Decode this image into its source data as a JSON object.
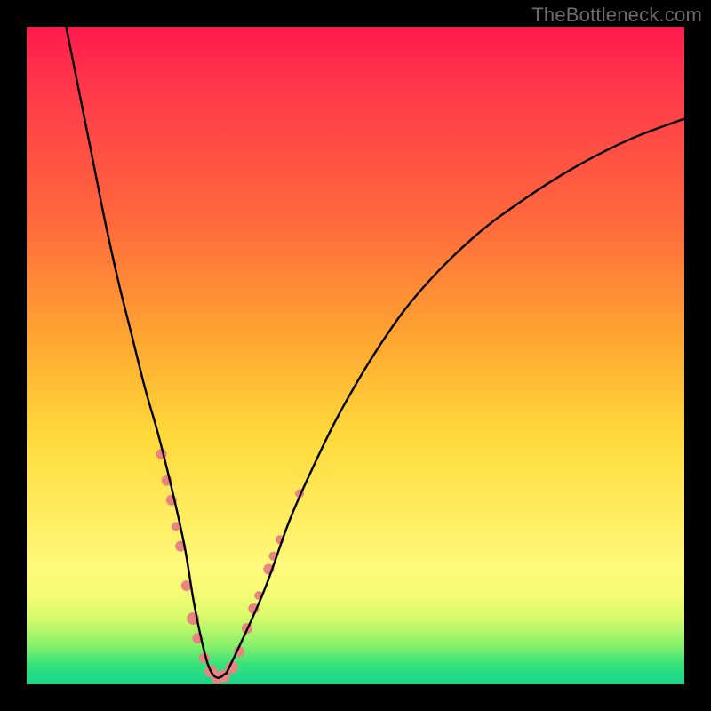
{
  "watermark": "TheBottleneck.com",
  "chart_data": {
    "type": "line",
    "title": "",
    "xlabel": "",
    "ylabel": "",
    "xlim": [
      0,
      100
    ],
    "ylim": [
      0,
      100
    ],
    "series": [
      {
        "name": "curve",
        "color": "#000000",
        "x": [
          6,
          8,
          10,
          12,
          14,
          16,
          18,
          20,
          22,
          24,
          25.5,
          27,
          28,
          29,
          30,
          31,
          36,
          40,
          44,
          48,
          54,
          60,
          68,
          76,
          84,
          92,
          100
        ],
        "y": [
          100,
          90,
          80,
          70,
          61,
          53,
          45,
          38,
          30,
          21,
          12,
          5,
          2,
          1,
          1.5,
          3,
          14,
          25,
          34,
          42,
          52,
          60,
          68,
          74,
          79,
          83,
          86
        ]
      }
    ],
    "markers": [
      {
        "name": "cluster-left",
        "color": "#e98481",
        "points": [
          {
            "x": 20.5,
            "y": 35,
            "r": 6
          },
          {
            "x": 21.3,
            "y": 31,
            "r": 6
          },
          {
            "x": 22.0,
            "y": 28,
            "r": 6
          },
          {
            "x": 22.7,
            "y": 24,
            "r": 5
          },
          {
            "x": 23.4,
            "y": 21,
            "r": 6
          },
          {
            "x": 24.3,
            "y": 15,
            "r": 6
          },
          {
            "x": 25.3,
            "y": 10,
            "r": 7
          },
          {
            "x": 26.0,
            "y": 7,
            "r": 6
          },
          {
            "x": 27.0,
            "y": 4,
            "r": 6
          },
          {
            "x": 28.0,
            "y": 2,
            "r": 7
          },
          {
            "x": 29.0,
            "y": 1,
            "r": 7
          },
          {
            "x": 30.0,
            "y": 1.3,
            "r": 7
          },
          {
            "x": 31.2,
            "y": 2.6,
            "r": 7
          },
          {
            "x": 32.3,
            "y": 5,
            "r": 6
          },
          {
            "x": 33.5,
            "y": 8.5,
            "r": 6
          },
          {
            "x": 34.5,
            "y": 11.5,
            "r": 6
          },
          {
            "x": 35.3,
            "y": 13.5,
            "r": 5
          },
          {
            "x": 36.8,
            "y": 17.5,
            "r": 6
          },
          {
            "x": 37.5,
            "y": 19.5,
            "r": 5
          },
          {
            "x": 38.5,
            "y": 22,
            "r": 5
          }
        ]
      },
      {
        "name": "outlier-right",
        "color": "#e98481",
        "points": [
          {
            "x": 41.5,
            "y": 29,
            "r": 5
          }
        ]
      }
    ]
  }
}
